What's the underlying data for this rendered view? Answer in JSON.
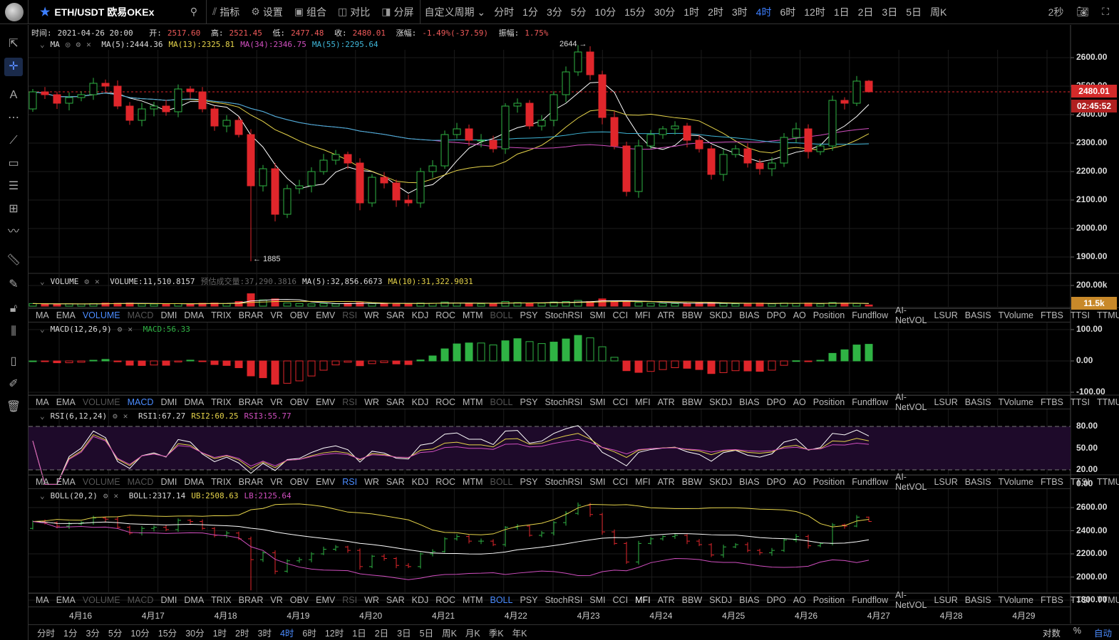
{
  "toolbar": {
    "symbol": "ETH/USDT 欧易OKEx",
    "buttons": [
      {
        "icon": "indicator-icon",
        "label": "指标"
      },
      {
        "icon": "gear-icon",
        "label": "设置"
      },
      {
        "icon": "combo-icon",
        "label": "组合"
      },
      {
        "icon": "compare-icon",
        "label": "对比"
      },
      {
        "icon": "split-screen-icon",
        "label": "分屏"
      }
    ],
    "custom_period": "自定义周期",
    "periods": [
      "分时",
      "1分",
      "3分",
      "5分",
      "10分",
      "15分",
      "30分",
      "1时",
      "2时",
      "3时",
      "4时",
      "6时",
      "12时",
      "1日",
      "2日",
      "3日",
      "5日",
      "周K"
    ],
    "active_period": "4时",
    "refresh": "2秒"
  },
  "info": {
    "time_label": "时间:",
    "time": "2021-04-26 20:00",
    "open_label": "开:",
    "open": "2517.60",
    "high_label": "高:",
    "high": "2521.45",
    "low_label": "低:",
    "low": "2477.48",
    "close_label": "收:",
    "close": "2480.01",
    "change_label": "涨幅:",
    "change": "-1.49%(-37.59)",
    "amp_label": "振幅:",
    "amp": "1.75%"
  },
  "ma_legend": {
    "name": "MA",
    "ma5": "MA(5):2444.36",
    "ma13": "MA(13):2325.81",
    "ma34": "MA(34):2346.75",
    "ma55": "MA(55):2295.64"
  },
  "volume_legend": {
    "name": "VOLUME",
    "volume": "VOLUME:11,510.8157",
    "est_label": "预估成交量:37,290.3816",
    "ma5": "MA(5):32,856.6673",
    "ma10": "MA(10):31,322.9031"
  },
  "macd_legend": {
    "name": "MACD(12,26,9)",
    "macd": "MACD:56.33"
  },
  "rsi_legend": {
    "name": "RSI(6,12,24)",
    "rsi1": "RSI1:67.27",
    "rsi2": "RSI2:60.25",
    "rsi3": "RSI3:55.77"
  },
  "boll_legend": {
    "name": "BOLL(20,2)",
    "boll": "BOLL:2317.14",
    "ub": "UB:2508.63",
    "lb": "LB:2125.64"
  },
  "indicator_tabs": [
    "MA",
    "EMA",
    "VOLUME",
    "MACD",
    "DMI",
    "DMA",
    "TRIX",
    "BRAR",
    "VR",
    "OBV",
    "EMV",
    "RSI",
    "WR",
    "SAR",
    "KDJ",
    "ROC",
    "MTM",
    "BOLL",
    "PSY",
    "StochRSI",
    "SMI",
    "CCI",
    "MFI",
    "ATR",
    "BBW",
    "SKDJ",
    "BIAS",
    "DPO",
    "AO",
    "Position",
    "Fundflow",
    "AI-NetVOL",
    "LSUR",
    "BASIS",
    "TVolume",
    "FTBS",
    "TTSI",
    "TTMU"
  ],
  "axes": {
    "price": [
      "2600.00",
      "2500.00",
      "2400.00",
      "2300.00",
      "2200.00",
      "2100.00",
      "2000.00",
      "1900.00"
    ],
    "price_tag": "2480.01",
    "countdown": "02:45:52",
    "volume": [
      "200.00k"
    ],
    "volume_tag": "11.5k",
    "macd": [
      "100.00",
      "0.00",
      "-100.00"
    ],
    "rsi": [
      "80.00",
      "50.00",
      "20.00",
      "0.00"
    ],
    "boll": [
      "2600.00",
      "2400.00",
      "2200.00",
      "2000.00",
      "1800.00"
    ]
  },
  "annotations": {
    "high": "2644 →",
    "low": "← 1885"
  },
  "dates": [
    "4月16",
    "4月17",
    "4月18",
    "4月19",
    "4月20",
    "4月21",
    "4月22",
    "4月23",
    "4月24",
    "4月25",
    "4月26",
    "4月27",
    "4月28",
    "4月29"
  ],
  "bottom": {
    "periods": [
      "分时",
      "1分",
      "3分",
      "5分",
      "10分",
      "15分",
      "30分",
      "1时",
      "2时",
      "3时",
      "4时",
      "6时",
      "12时",
      "1日",
      "2日",
      "3日",
      "5日",
      "周K",
      "月K",
      "季K",
      "年K"
    ],
    "active": "4时",
    "log": "对数",
    "percent": "%",
    "auto": "自动"
  },
  "colors": {
    "up": "#2fb344",
    "down": "#e0262b",
    "ma5": "#ffffff",
    "ma13": "#e6d44a",
    "ma34": "#d14fc0",
    "ma55": "#3fb6d8",
    "accent": "#4b8cff"
  },
  "chart_data": {
    "type": "candlestick",
    "interval": "4h",
    "first_open": 2420,
    "close": [
      2480,
      2470,
      2440,
      2460,
      2470,
      2510,
      2500,
      2430,
      2380,
      2420,
      2430,
      2410,
      2490,
      2480,
      2420,
      2360,
      2380,
      2330,
      2150,
      2210,
      2050,
      2140,
      2150,
      2200,
      2240,
      2260,
      2230,
      2090,
      2180,
      2160,
      2100,
      2090,
      2200,
      2220,
      2330,
      2350,
      2310,
      2310,
      2280,
      2430,
      2440,
      2360,
      2380,
      2470,
      2550,
      2620,
      2540,
      2390,
      2290,
      2130,
      2290,
      2330,
      2350,
      2360,
      2310,
      2280,
      2190,
      2260,
      2280,
      2230,
      2210,
      2230,
      2320,
      2350,
      2270,
      2290,
      2450,
      2440,
      2517.6,
      2480.01
    ],
    "extreme_high": {
      "45": 2644,
      "69": 2521.45
    },
    "extreme_low": {
      "18": 1885,
      "69": 2477.48
    },
    "volume_k": [
      25,
      22,
      20,
      22,
      20,
      25,
      30,
      28,
      30,
      22,
      20,
      22,
      25,
      22,
      28,
      30,
      25,
      45,
      120,
      60,
      70,
      30,
      25,
      22,
      25,
      22,
      28,
      35,
      25,
      22,
      28,
      25,
      30,
      28,
      40,
      30,
      25,
      22,
      25,
      45,
      35,
      30,
      28,
      40,
      45,
      55,
      45,
      70,
      45,
      50,
      35,
      28,
      25,
      25,
      28,
      30,
      35,
      25,
      22,
      28,
      30,
      22,
      30,
      25,
      30,
      22,
      35,
      30,
      25,
      11.5
    ],
    "price_range": [
      1800,
      2650
    ]
  }
}
